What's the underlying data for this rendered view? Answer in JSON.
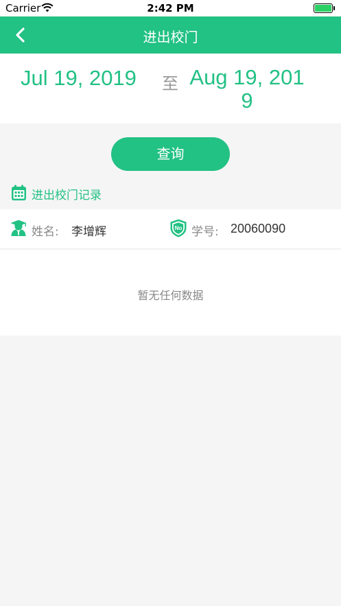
{
  "status_bar": {
    "carrier": "Carrier",
    "time": "2:42 PM"
  },
  "nav": {
    "title": "进出校门",
    "back_icon": "chevron-left-icon"
  },
  "date_range": {
    "start": "Jul 19, 2019",
    "separator": "至",
    "end": "Aug 19, 2019"
  },
  "query_button": {
    "label": "查询"
  },
  "section": {
    "title": "进出校门记录",
    "icon": "calendar-icon"
  },
  "student": {
    "name_label": "姓名:",
    "name": "李增辉",
    "id_label": "学号:",
    "id": "20060090",
    "id_badge": "No"
  },
  "records": {
    "empty_text": "暂无任何数据"
  },
  "colors": {
    "accent": "#22c184",
    "background": "#f5f5f5",
    "text": "#333333",
    "muted": "#888888"
  }
}
